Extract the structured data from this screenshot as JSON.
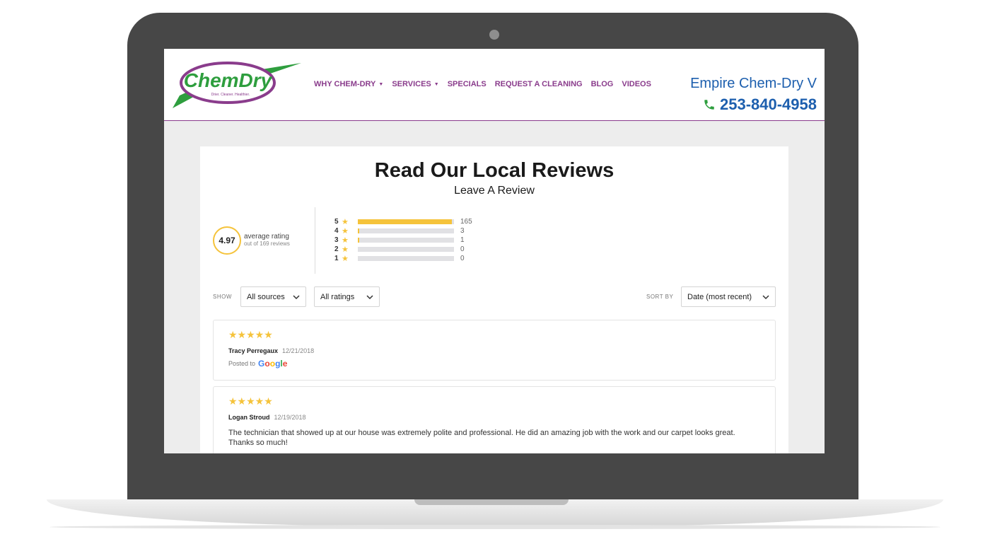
{
  "site": {
    "logo": {
      "brand": "ChemDry",
      "tagline": "Drier. Cleaner. Healthier."
    },
    "nav": [
      {
        "label": "WHY CHEM-DRY",
        "dropdown": true
      },
      {
        "label": "SERVICES",
        "dropdown": true
      },
      {
        "label": "SPECIALS",
        "dropdown": false
      },
      {
        "label": "REQUEST A CLEANING",
        "dropdown": false
      },
      {
        "label": "BLOG",
        "dropdown": false
      },
      {
        "label": "VIDEOS",
        "dropdown": false
      }
    ],
    "business_name": "Empire Chem-Dry V",
    "phone": "253-840-4958"
  },
  "reviews_page": {
    "title": "Read Our Local Reviews",
    "leave_review": "Leave A Review",
    "average": {
      "value": "4.97",
      "label": "average rating",
      "sub": "out of 169 reviews"
    },
    "breakdown": [
      {
        "stars": "5",
        "count": "165",
        "fraction": 0.976
      },
      {
        "stars": "4",
        "count": "3",
        "fraction": 0.018
      },
      {
        "stars": "3",
        "count": "1",
        "fraction": 0.006
      },
      {
        "stars": "2",
        "count": "0",
        "fraction": 0
      },
      {
        "stars": "1",
        "count": "0",
        "fraction": 0
      }
    ],
    "filters": {
      "show_label": "SHOW",
      "sources": "All sources",
      "ratings": "All ratings",
      "sort_label": "SORT BY",
      "sort": "Date (most recent)"
    },
    "reviews": [
      {
        "stars": "★★★★★",
        "name": "Tracy Perregaux",
        "date": "12/21/2018",
        "posted_to": "Posted to",
        "source": "Google",
        "text": ""
      },
      {
        "stars": "★★★★★",
        "name": "Logan Stroud",
        "date": "12/19/2018",
        "text": "The technician that showed up at our house was extremely polite and professional. He did an amazing job with the work and our carpet looks great. Thanks so much!"
      }
    ]
  },
  "colors": {
    "brand_purple": "#8a3c8c",
    "brand_blue": "#1d5fae",
    "brand_green": "#2e9e3e",
    "star_yellow": "#f5c33b"
  }
}
